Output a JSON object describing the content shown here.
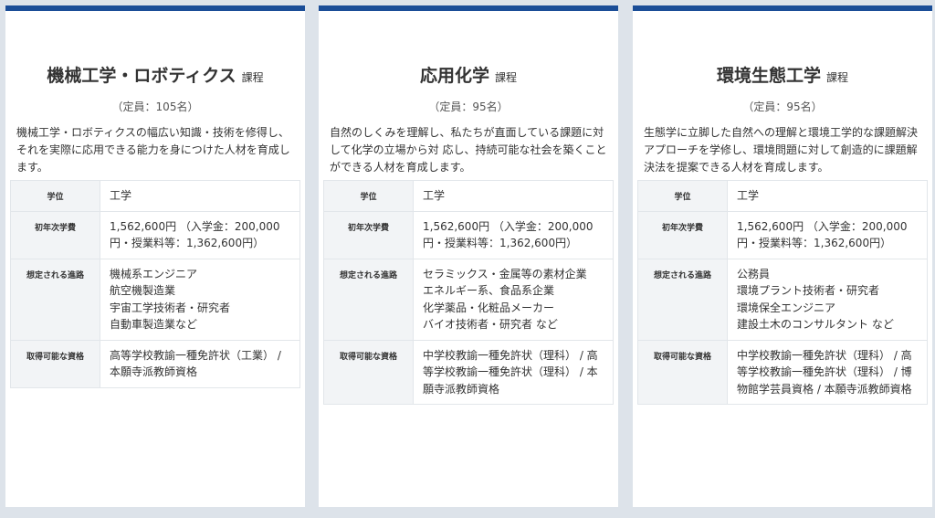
{
  "courses": [
    {
      "name": "機械工学・ロボティクス",
      "suffix": "課程",
      "capacity": "（定員：105名）",
      "description": "機械工学・ロボティクスの幅広い知識・技術を修得し、それを実際に応用できる能力を身につけた人材を育成します。",
      "rows": [
        {
          "label": "学位",
          "lines": [
            "工学"
          ]
        },
        {
          "label": "初年次学費",
          "lines": [
            "1,562,600円 （入学金：200,000円・授業料等：1,362,600円）"
          ]
        },
        {
          "label": "想定される進路",
          "lines": [
            "機械系エンジニア",
            "航空機製造業",
            "宇宙工学技術者・研究者",
            "自動車製造業など"
          ]
        },
        {
          "label": "取得可能な資格",
          "lines": [
            "高等学校教諭一種免許状（工業） / 本願寺派教師資格"
          ]
        }
      ]
    },
    {
      "name": "応用化学",
      "suffix": "課程",
      "capacity": "（定員：95名）",
      "description": "自然のしくみを理解し、私たちが直面している課題に対して化学の立場から対 応し、持続可能な社会を築くことができる人材を育成します。",
      "rows": [
        {
          "label": "学位",
          "lines": [
            "工学"
          ]
        },
        {
          "label": "初年次学費",
          "lines": [
            "1,562,600円 （入学金：200,000円・授業料等：1,362,600円）"
          ]
        },
        {
          "label": "想定される進路",
          "lines": [
            "セラミックス・金属等の素材企業",
            "エネルギー系、食品系企業",
            "化学薬品・化粧品メーカー",
            "バイオ技術者・研究者 など"
          ]
        },
        {
          "label": "取得可能な資格",
          "lines": [
            "中学校教諭一種免許状（理科） / 高等学校教諭一種免許状（理科） / 本願寺派教師資格"
          ]
        }
      ]
    },
    {
      "name": "環境生態工学",
      "suffix": "課程",
      "capacity": "（定員：95名）",
      "description": "生態学に立脚した自然への理解と環境工学的な課題解決アプローチを学修し、環境問題に対して創造的に課題解決法を提案できる人材を育成します。",
      "rows": [
        {
          "label": "学位",
          "lines": [
            "工学"
          ]
        },
        {
          "label": "初年次学費",
          "lines": [
            "1,562,600円 （入学金：200,000円・授業料等：1,362,600円）"
          ]
        },
        {
          "label": "想定される進路",
          "lines": [
            "公務員",
            "環境プラント技術者・研究者",
            "環境保全エンジニア",
            "建設土木のコンサルタント など"
          ]
        },
        {
          "label": "取得可能な資格",
          "lines": [
            "中学校教諭一種免許状（理科） / 高等学校教諭一種免許状（理科） / 博物館学芸員資格 / 本願寺派教師資格"
          ]
        }
      ]
    }
  ],
  "colors": {
    "accent": "#1a4d97",
    "header_bg": "#f2f4f6",
    "page_bg": "#dde3ea"
  }
}
